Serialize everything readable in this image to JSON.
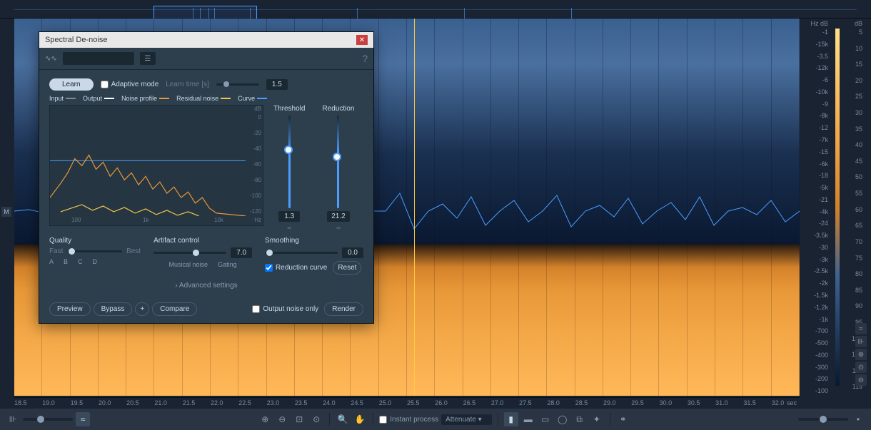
{
  "dialog": {
    "title": "Spectral De-noise",
    "learn_btn": "Learn",
    "adaptive_mode": "Adaptive mode",
    "learn_time_label": "Learn time [s]",
    "learn_time_value": "1.5",
    "legend": {
      "input": "Input",
      "output": "Output",
      "noise_profile": "Noise profile",
      "residual_noise": "Residual noise",
      "curve": "Curve"
    },
    "threshold": {
      "label": "Threshold",
      "value": "1.3"
    },
    "reduction": {
      "label": "Reduction",
      "value": "21.2"
    },
    "quality": {
      "label": "Quality",
      "fast": "Fast",
      "best": "Best",
      "a": "A",
      "b": "B",
      "c": "C",
      "d": "D"
    },
    "artifact": {
      "label": "Artifact control",
      "value": "7.0",
      "musical": "Musical noise",
      "gating": "Gating"
    },
    "smoothing": {
      "label": "Smoothing",
      "value": "0.0",
      "reduction_curve": "Reduction curve",
      "reset": "Reset"
    },
    "advanced": "Advanced settings",
    "preview": "Preview",
    "bypass": "Bypass",
    "plus": "+",
    "compare": "Compare",
    "output_noise_only": "Output noise only",
    "render": "Render",
    "graph": {
      "db_unit": "dB",
      "hz_unit": "Hz",
      "db_ticks": [
        "0",
        "-20",
        "-40",
        "-60",
        "-80",
        "-100",
        "-120"
      ],
      "hz_ticks": [
        "100",
        "1k",
        "10k"
      ]
    }
  },
  "freq_scale": {
    "unit": "Hz dB",
    "ticks": [
      "-1",
      "-15k",
      "-3.5",
      "-12k",
      "-6",
      "-10k",
      "-9",
      "-8k",
      "-12",
      "-7k",
      "-15",
      "-6k",
      "-18",
      "-5k",
      "-21",
      "-4k",
      "-24",
      "-3.5k",
      "-30",
      "-3k",
      "-2.5k",
      "-2k",
      "-1.5k",
      "-1.2k",
      "-1k",
      "-700",
      "-500",
      "-400",
      "-300",
      "-200",
      "-100"
    ]
  },
  "db_scale": {
    "unit": "dB",
    "ticks": [
      "5",
      "10",
      "15",
      "20",
      "25",
      "30",
      "35",
      "40",
      "45",
      "50",
      "55",
      "60",
      "65",
      "70",
      "75",
      "80",
      "85",
      "90",
      "95",
      "100",
      "105",
      "110",
      "115"
    ]
  },
  "timeline": {
    "unit": "sec",
    "ticks": [
      "18.5",
      "19.0",
      "19.5",
      "20.0",
      "20.5",
      "21.0",
      "21.5",
      "22.0",
      "22.5",
      "23.0",
      "23.5",
      "24.0",
      "24.5",
      "25.0",
      "25.5",
      "26.0",
      "26.5",
      "27.0",
      "27.5",
      "28.0",
      "28.5",
      "29.0",
      "29.5",
      "30.0",
      "30.5",
      "31.0",
      "31.5",
      "32.0"
    ]
  },
  "bottombar": {
    "instant_process": "Instant process",
    "attenuate": "Attenuate"
  },
  "channel": "M"
}
